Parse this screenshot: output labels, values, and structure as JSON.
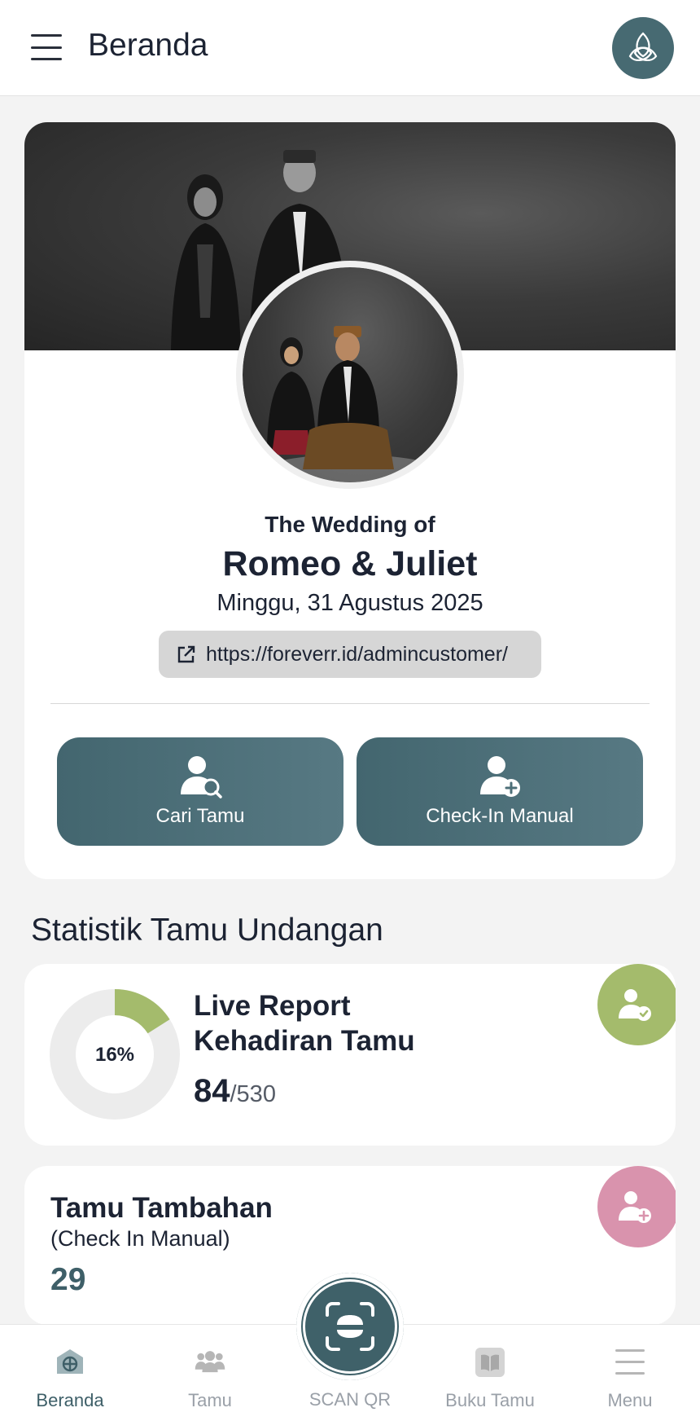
{
  "appbar": {
    "title": "Beranda",
    "menu_icon": "hamburger-icon",
    "logo_icon": "trinity-knot-logo"
  },
  "profile": {
    "wedding_of": "The Wedding of",
    "couple": "Romeo & Juliet",
    "date": "Minggu, 31 Agustus 2025",
    "url": "https://foreverr.id/admincustomer/",
    "url_icon": "external-link-icon"
  },
  "actions": {
    "search_guest": "Cari Tamu",
    "manual_checkin": "Check-In Manual"
  },
  "stats": {
    "section_title": "Statistik Tamu Undangan",
    "live": {
      "title_line1": "Live Report",
      "title_line2": "Kehadiran Tamu",
      "percent_label": "16%",
      "percent": 0.16,
      "present": "84",
      "total": "/530"
    },
    "extra": {
      "title": "Tamu Tambahan",
      "subtitle": "(Check In Manual)",
      "count": "29"
    }
  },
  "nav": {
    "home": "Beranda",
    "guests": "Tamu",
    "scan": "SCAN QR",
    "guestbook": "Buku Tamu",
    "menu": "Menu"
  },
  "colors": {
    "primary": "#3e5f68",
    "accent_green": "#a4bb6c",
    "accent_pink": "#d993ad",
    "url_pill": "#d6d6d6"
  }
}
